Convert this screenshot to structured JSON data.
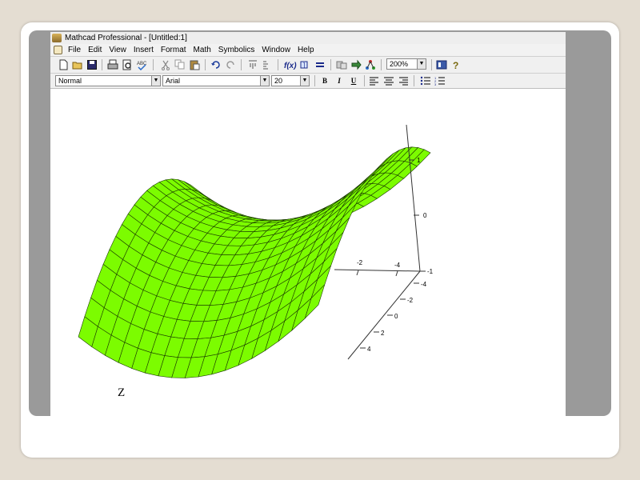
{
  "window": {
    "title": "Mathcad Professional - [Untitled:1]"
  },
  "menu": {
    "items": [
      {
        "label": "File",
        "id": "file"
      },
      {
        "label": "Edit",
        "id": "edit"
      },
      {
        "label": "View",
        "id": "view"
      },
      {
        "label": "Insert",
        "id": "insert"
      },
      {
        "label": "Format",
        "id": "format"
      },
      {
        "label": "Math",
        "id": "math"
      },
      {
        "label": "Symbolics",
        "id": "symbolics"
      },
      {
        "label": "Window",
        "id": "window"
      },
      {
        "label": "Help",
        "id": "help"
      }
    ]
  },
  "toolbar": {
    "zoom": "200%"
  },
  "format_bar": {
    "style": "Normal",
    "font": "Arial",
    "size": "20",
    "bold": "B",
    "italic": "I",
    "underline": "U"
  },
  "plot": {
    "z_axis_ticks": [
      "1",
      "0",
      "-1"
    ],
    "x_axis_ticks": [
      "-2",
      "-4"
    ],
    "y_axis_ticks": [
      "-4",
      "-2",
      "0",
      "2",
      "4"
    ],
    "surface_color": "#7cfc00",
    "mesh_color": "#1a3a00"
  },
  "worksheet": {
    "expression_label": "Z"
  }
}
